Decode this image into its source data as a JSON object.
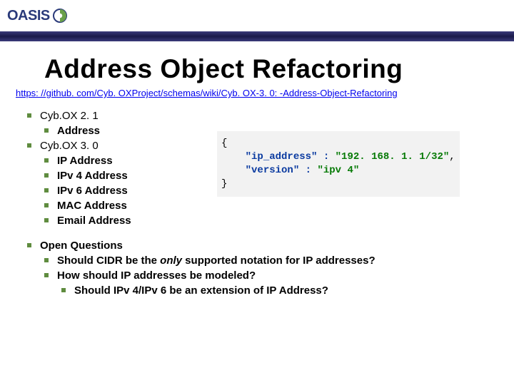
{
  "logo_text": "OASIS",
  "title": "Address Object Refactoring",
  "link_text": "https: //github. com/Cyb. OXProject/schemas/wiki/Cyb. OX-3. 0: -Address-Object-Refactoring",
  "list": {
    "item1": "Cyb.OX 2. 1",
    "item1a": "Address",
    "item2": "Cyb.OX 3. 0",
    "item2a": "IP Address",
    "item2b": "IPv 4 Address",
    "item2c": "IPv 6 Address",
    "item2d": "MAC Address",
    "item2e": "Email Address"
  },
  "snippet": {
    "line1": "{",
    "key1": "\"ip_address\"",
    "val1": "\"192. 168. 1. 1/32\"",
    "comma1": ",",
    "key2": "\"version\"",
    "val2": "\"ipv 4\"",
    "line4": "}"
  },
  "open": {
    "heading": "Open Questions",
    "q1_a": "Should CIDR be the ",
    "q1_b": "only",
    "q1_c": " supported notation for IP addresses?",
    "q2": "How should IP addresses be modeled?",
    "q2a": "Should IPv 4/IPv 6 be an extension of IP Address?"
  }
}
